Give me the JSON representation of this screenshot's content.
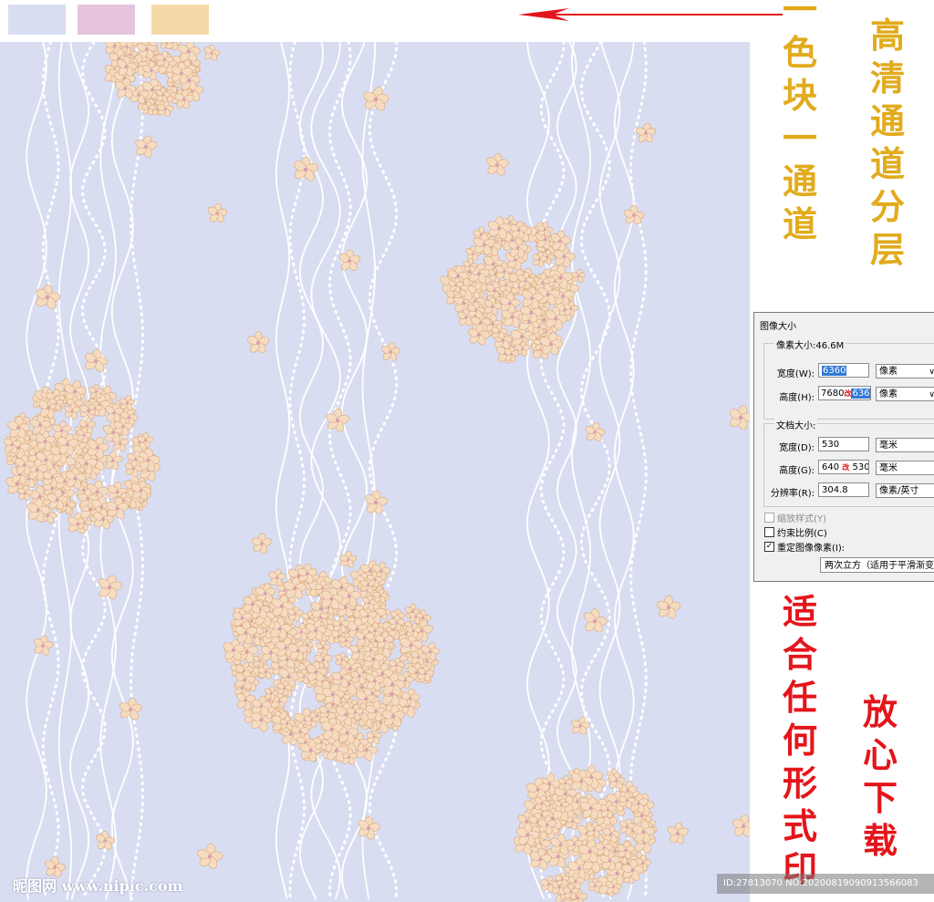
{
  "swatches": [
    {
      "name": "swatch-blue",
      "color": "#d9ddf1"
    },
    {
      "name": "swatch-pink",
      "color": "#e6c4de"
    },
    {
      "name": "swatch-tan",
      "color": "#f5d9a8"
    }
  ],
  "colors": {
    "pattern_bg": "#d9ddf1",
    "arrow": "#e4151b",
    "gold_text": "#e2ab1d",
    "red_text": "#e4151b",
    "flower_fill": "#f5dcc1",
    "flower_edge": "#d9a77f"
  },
  "annotations": {
    "gold_col1": [
      "一",
      "色",
      "块",
      "一",
      "通",
      "道"
    ],
    "gold_col2": [
      "高",
      "清",
      "通",
      "道",
      "分",
      "层"
    ],
    "red_col1": [
      "适",
      "合",
      "任",
      "何",
      "形",
      "式",
      "印"
    ],
    "red_col2": [
      "放",
      "心",
      "下",
      "载"
    ]
  },
  "dialog": {
    "title": "图像大小",
    "pixel_dimensions_label": "像素大小:46.6M",
    "width_label": "宽度(W):",
    "width_value": "6360",
    "width_unit": "像素",
    "height_label": "高度(H):",
    "height_value_old": "7680",
    "height_value_new": "6360",
    "height_unit": "像素",
    "doc_size_label": "文档大小:",
    "doc_width_label": "宽度(D):",
    "doc_width_value": "530",
    "doc_width_unit": "毫米",
    "doc_height_label": "高度(G):",
    "doc_height_value_old": "640",
    "doc_height_value_new": "530",
    "doc_height_unit": "毫米",
    "resolution_label": "分辨率(R):",
    "resolution_value": "304.8",
    "resolution_unit": "像素/英寸",
    "change_mark": "改",
    "scale_styles_label": "缩放样式(Y)",
    "constrain_label": "约束比例(C)",
    "resample_label": "重定图像像素(I):",
    "resample_method": "两次立方（适用于平滑渐变",
    "caret": "∨",
    "check_mark": "✓"
  },
  "watermark": {
    "site": "昵图网 www.nipic.com",
    "id_text": "ID:27813070 NO:20200819090913566083"
  }
}
